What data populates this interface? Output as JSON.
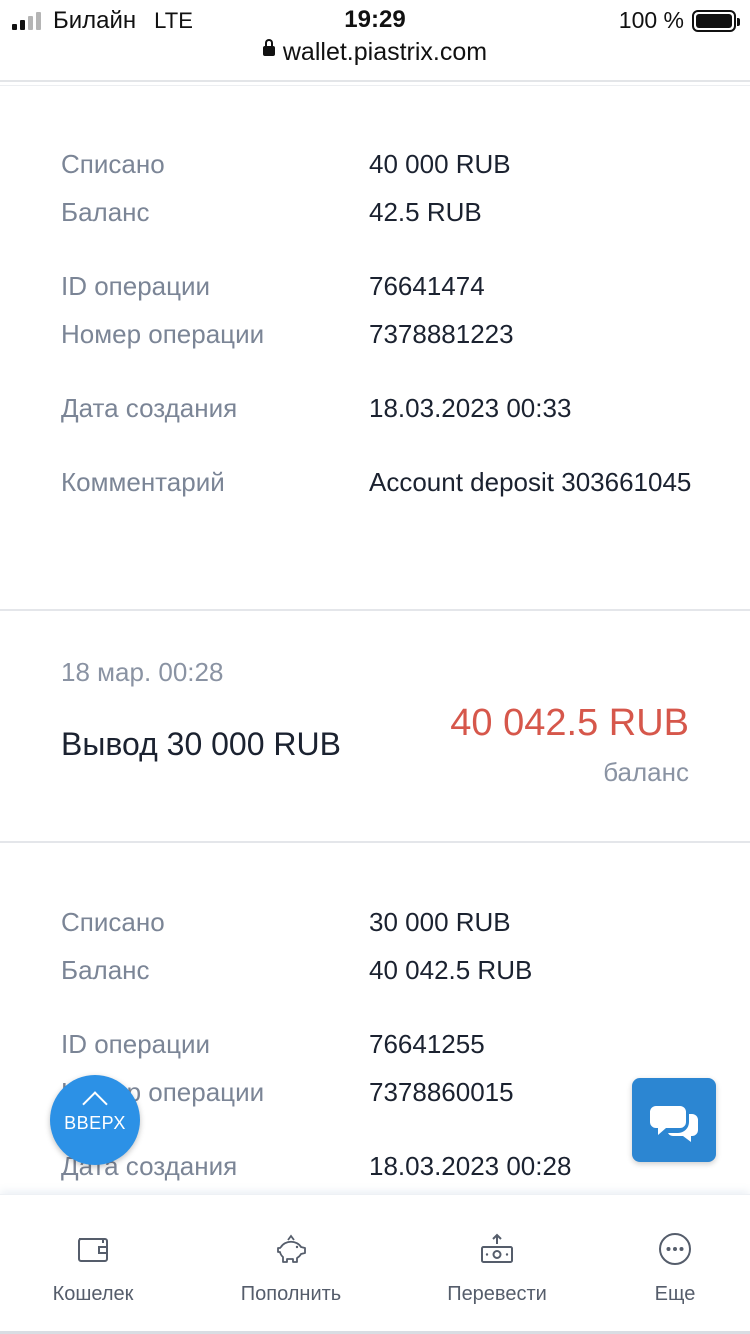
{
  "status_bar": {
    "carrier": "Билайн",
    "network": "LTE",
    "time": "19:29",
    "battery": "100 %",
    "url": "wallet.piastrix.com"
  },
  "operation1": {
    "debited_label": "Списано",
    "debited_value": "40 000 RUB",
    "balance_label": "Баланс",
    "balance_value": "42.5 RUB",
    "op_id_label": "ID операции",
    "op_id_value": "76641474",
    "op_number_label": "Номер операции",
    "op_number_value": "7378881223",
    "created_label": "Дата создания",
    "created_value": "18.03.2023 00:33",
    "comment_label": "Комментарий",
    "comment_value": "Account deposit 303661045"
  },
  "transaction2": {
    "date": "18 мар.  00:28",
    "title": "Вывод 30 000 RUB",
    "amount": "40 042.5 RUB",
    "amount_caption": "баланс",
    "amount_color": "#d6574b"
  },
  "operation2": {
    "debited_label": "Списано",
    "debited_value": "30 000 RUB",
    "balance_label": "Баланс",
    "balance_value": "40 042.5 RUB",
    "op_id_label": "ID операции",
    "op_id_value": "76641255",
    "op_number_label": "Номер операции",
    "op_number_value": "7378860015",
    "created_label": "Дата создания",
    "created_value": "18.03.2023 00:28"
  },
  "scroll_up_button": {
    "label": "ВВЕРХ",
    "icon": "chevron-up-icon"
  },
  "chat_button": {
    "icon": "chat-bubbles-icon"
  },
  "tabbar": {
    "items": [
      {
        "label": "Кошелек",
        "icon": "wallet-icon"
      },
      {
        "label": "Пополнить",
        "icon": "piggy-bank-icon"
      },
      {
        "label": "Перевести",
        "icon": "money-transfer-icon"
      },
      {
        "label": "Еще",
        "icon": "more-dots-icon"
      }
    ]
  },
  "colors": {
    "accent": "#2c91e6",
    "negative": "#d6574b",
    "label": "#7b8596"
  }
}
